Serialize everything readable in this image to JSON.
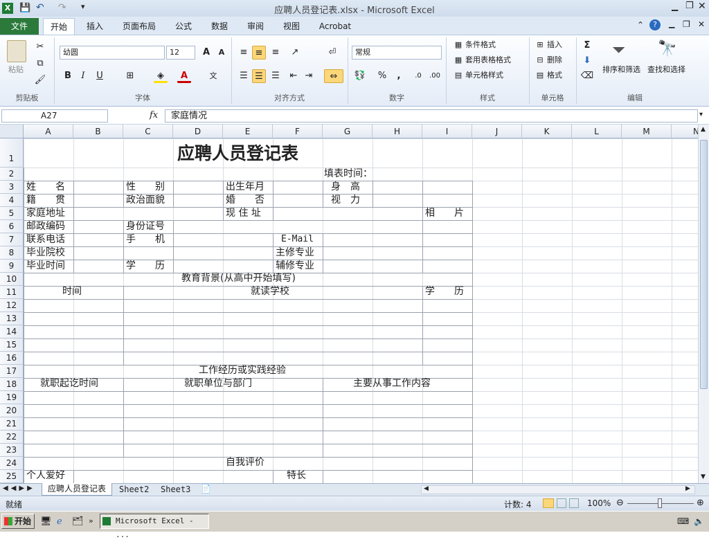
{
  "window": {
    "title": "应聘人员登记表.xlsx - Microsoft Excel"
  },
  "tabs": [
    "文件",
    "开始",
    "插入",
    "页面布局",
    "公式",
    "数据",
    "审阅",
    "视图",
    "Acrobat"
  ],
  "ribbon": {
    "paste": "粘贴",
    "font_name": "幼圆",
    "font_size": "12",
    "number_format": "常规",
    "cond_format": "条件格式",
    "table_format": "套用表格格式",
    "cell_style": "单元格样式",
    "insert": "插入",
    "delete": "删除",
    "format": "格式",
    "sort_filter": "排序和筛选",
    "find_select": "查找和选择",
    "groups": [
      "剪贴板",
      "字体",
      "对齐方式",
      "数字",
      "样式",
      "单元格",
      "编辑"
    ]
  },
  "formula": {
    "name_box": "A27",
    "fx": "fx",
    "content": "家庭情况"
  },
  "columns": [
    "A",
    "B",
    "C",
    "D",
    "E",
    "F",
    "G",
    "H",
    "I",
    "J",
    "K",
    "L",
    "M",
    "N"
  ],
  "rows": [
    "1",
    "2",
    "3",
    "4",
    "5",
    "6",
    "7",
    "8",
    "9",
    "10",
    "11",
    "12",
    "13",
    "14",
    "15",
    "16",
    "17",
    "18",
    "19",
    "20",
    "21",
    "22",
    "23",
    "24",
    "25"
  ],
  "sheet": {
    "title": "应聘人员登记表",
    "fill_time": "填表时间：",
    "name": "姓　　名",
    "gender": "性　　别",
    "birth": "出生年月",
    "height": "身　高",
    "native": "籍　　贯",
    "politics": "政治面貌",
    "married": "婚　　否",
    "vision": "视　力",
    "address": "家庭地址",
    "current_addr": "现 住 址",
    "photo": "相　　片",
    "zip": "邮政编码",
    "id": "身份证号",
    "phone": "联系电话",
    "mobile": "手　　机",
    "email": "E-Mail",
    "school": "毕业院校",
    "major": "主修专业",
    "grad_time": "毕业时间",
    "degree": "学　　历",
    "minor": "辅修专业",
    "edu_bg": "教育背景(从高中开始填写)",
    "time": "时间",
    "school_att": "就读学校",
    "degree2": "学　　历",
    "work_exp": "工作经历或实践经验",
    "work_period": "就职起讫时间",
    "work_unit": "就职单位与部门",
    "work_content": "主要从事工作内容",
    "self_eval": "自我评价",
    "hobby": "个人爱好",
    "specialty": "特长"
  },
  "sheet_tabs": [
    "应聘人员登记表",
    "Sheet2",
    "Sheet3"
  ],
  "status": {
    "ready": "就绪",
    "count": "计数: 4",
    "zoom": "100%"
  },
  "taskbar": {
    "start": "开始",
    "excel": "Microsoft Excel - ..."
  }
}
